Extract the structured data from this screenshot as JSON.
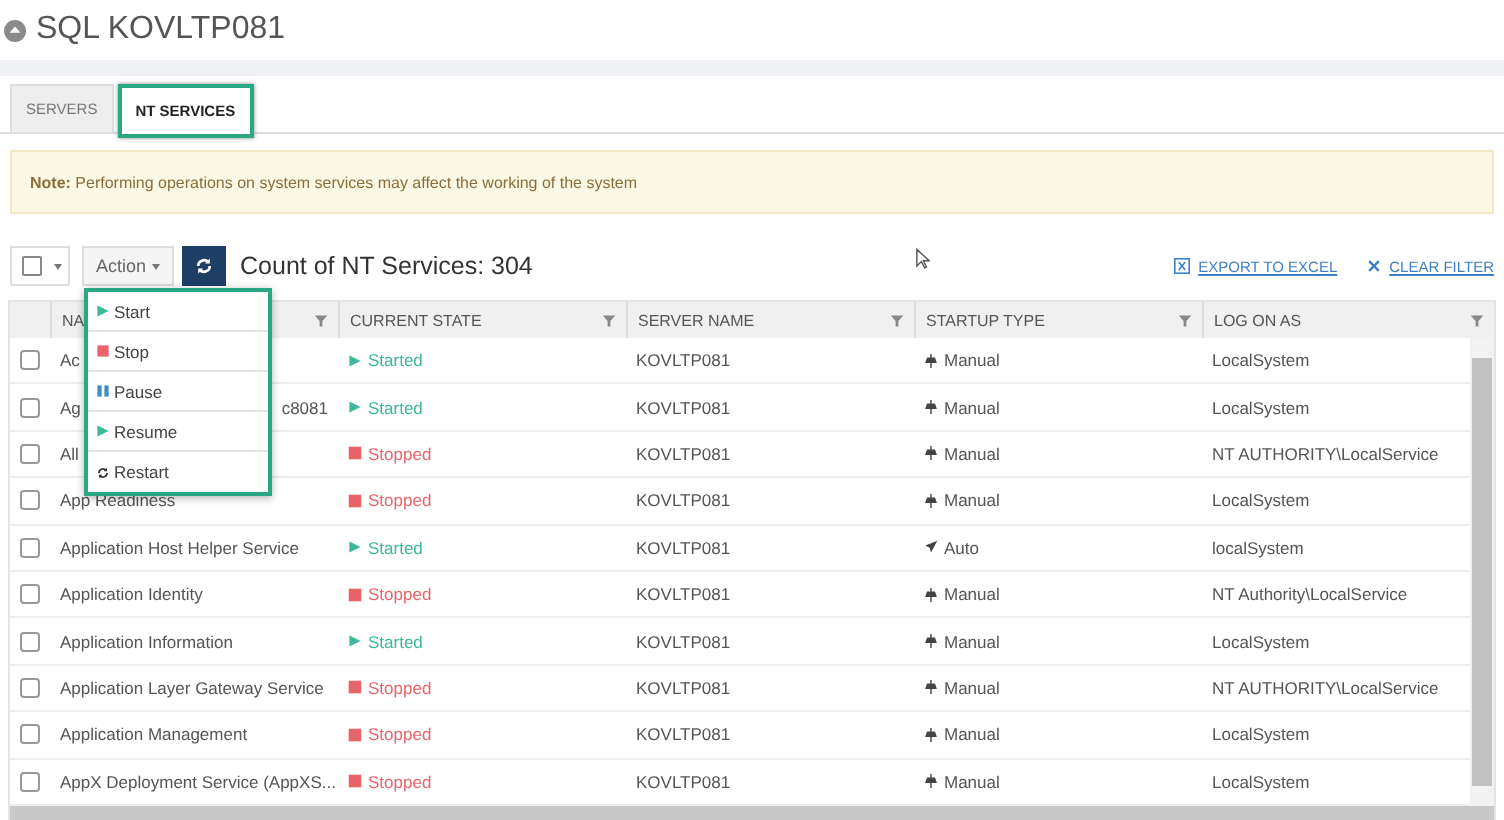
{
  "page": {
    "title": "SQL KOVLTP081"
  },
  "tabs": [
    {
      "label": "SERVERS",
      "selected": false
    },
    {
      "label": "NT SERVICES",
      "selected": true
    }
  ],
  "note": {
    "text": "**Note:** Performing operations on system services may affect the working of the system"
  },
  "toolbar": {
    "action_label": "Action",
    "count": "Count of NT Services: 304",
    "export_link": "EXPORT TO EXCEL",
    "clear_link": "CLEAR FILTER"
  },
  "action_menu": [
    {
      "kind": "start",
      "label": "Start"
    },
    {
      "kind": "stop",
      "label": "Stop"
    },
    {
      "kind": "pause",
      "label": "Pause"
    },
    {
      "kind": "resume",
      "label": "Resume"
    },
    {
      "kind": "restart",
      "label": "Restart"
    }
  ],
  "table": {
    "columns": [
      "NA",
      "CURRENT STATE",
      "SERVER NAME",
      "STARTUP TYPE",
      "LOG ON AS"
    ],
    "rows": [
      {
        "checked": false,
        "name": "Ac",
        "state": {
          "kind": "started",
          "label": "Started"
        },
        "server": "KOVLTP081",
        "startup": {
          "kind": "manual",
          "label": "Manual"
        },
        "logon": "LocalSystem"
      },
      {
        "checked": false,
        "name": "Ag",
        "name_tail": "c8081",
        "state": {
          "kind": "started",
          "label": "Started"
        },
        "server": "KOVLTP081",
        "startup": {
          "kind": "manual",
          "label": "Manual"
        },
        "logon": "LocalSystem"
      },
      {
        "checked": false,
        "name": "All",
        "state": {
          "kind": "stopped",
          "label": "Stopped"
        },
        "server": "KOVLTP081",
        "startup": {
          "kind": "manual",
          "label": "Manual"
        },
        "logon": "NT AUTHORITY\\LocalService"
      },
      {
        "checked": false,
        "name": "App Readiness",
        "state": {
          "kind": "stopped",
          "label": "Stopped"
        },
        "server": "KOVLTP081",
        "startup": {
          "kind": "manual",
          "label": "Manual"
        },
        "logon": "LocalSystem"
      },
      {
        "checked": false,
        "name": "Application Host Helper Service",
        "state": {
          "kind": "started",
          "label": "Started"
        },
        "server": "KOVLTP081",
        "startup": {
          "kind": "auto",
          "label": "Auto"
        },
        "logon": "localSystem"
      },
      {
        "checked": false,
        "name": "Application Identity",
        "state": {
          "kind": "stopped",
          "label": "Stopped"
        },
        "server": "KOVLTP081",
        "startup": {
          "kind": "manual",
          "label": "Manual"
        },
        "logon": "NT Authority\\LocalService"
      },
      {
        "checked": false,
        "name": "Application Information",
        "state": {
          "kind": "started",
          "label": "Started"
        },
        "server": "KOVLTP081",
        "startup": {
          "kind": "manual",
          "label": "Manual"
        },
        "logon": "LocalSystem"
      },
      {
        "checked": false,
        "name": "Application Layer Gateway Service",
        "state": {
          "kind": "stopped",
          "label": "Stopped"
        },
        "server": "KOVLTP081",
        "startup": {
          "kind": "manual",
          "label": "Manual"
        },
        "logon": "NT AUTHORITY\\LocalService"
      },
      {
        "checked": false,
        "name": "Application Management",
        "state": {
          "kind": "stopped",
          "label": "Stopped"
        },
        "server": "KOVLTP081",
        "startup": {
          "kind": "manual",
          "label": "Manual"
        },
        "logon": "LocalSystem"
      },
      {
        "checked": false,
        "name": "AppX Deployment Service (AppXS...",
        "state": {
          "kind": "stopped",
          "label": "Stopped"
        },
        "server": "KOVLTP081",
        "startup": {
          "kind": "manual",
          "label": "Manual"
        },
        "logon": "LocalSystem"
      }
    ]
  }
}
